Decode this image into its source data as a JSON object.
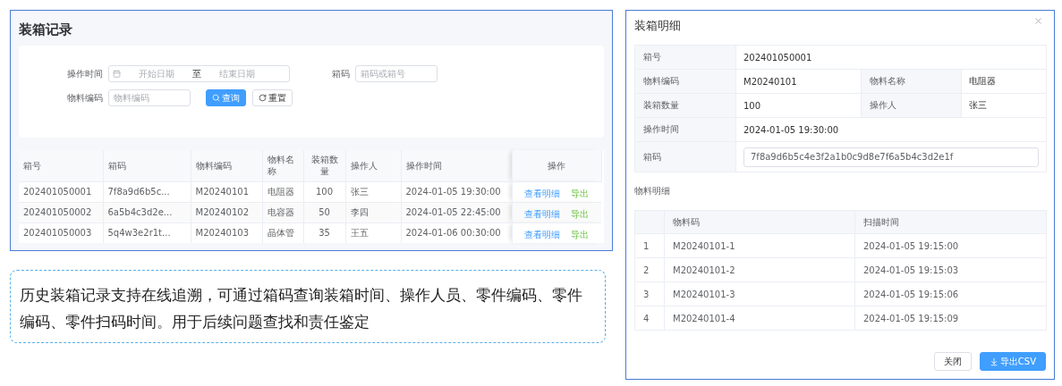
{
  "records_panel": {
    "title": "装箱记录",
    "filters": {
      "time_label": "操作时间",
      "start_placeholder": "开始日期",
      "range_separator": "至",
      "end_placeholder": "结束日期",
      "box_code_label": "箱码",
      "box_code_placeholder": "箱码或箱号",
      "material_label": "物料编码",
      "material_placeholder": "物料编码",
      "buttons": [
        {
          "kind": "primary",
          "label": "查询"
        },
        {
          "kind": "default",
          "label": "重置"
        }
      ]
    },
    "table": {
      "columns": [
        "箱号",
        "箱码",
        "物料编码",
        "物料名称",
        "装箱数量",
        "操作人",
        "操作时间",
        "操作"
      ],
      "rows": [
        {
          "cells": [
            "202401050001",
            "7f8a9d6b5c...",
            "M20240101",
            "电阻器",
            "100",
            "张三",
            "2024-01-05 19:30:00"
          ],
          "actions": [
            {
              "kind": "detail",
              "label": "查看明细"
            },
            {
              "kind": "export",
              "label": "导出"
            }
          ]
        },
        {
          "cells": [
            "202401050002",
            "6a5b4c3d2e...",
            "M20240102",
            "电容器",
            "50",
            "李四",
            "2024-01-05 22:45:00"
          ],
          "actions": [
            {
              "kind": "detail",
              "label": "查看明细"
            },
            {
              "kind": "export",
              "label": "导出"
            }
          ]
        },
        {
          "cells": [
            "202401050003",
            "5q4w3e2r1t...",
            "M20240103",
            "晶体管",
            "35",
            "王五",
            "2024-01-06 00:30:00"
          ],
          "actions": [
            {
              "kind": "detail",
              "label": "查看明细"
            },
            {
              "kind": "export",
              "label": "导出"
            }
          ]
        }
      ]
    }
  },
  "caption": "历史装箱记录支持在线追溯，可通过箱码查询装箱时间、操作人员、零件编码、零件编码、零件扫码时间。用于后续问题查找和责任鉴定",
  "detail_dialog": {
    "title": "装箱明细",
    "fields": [
      [
        {
          "kind": "text",
          "label": "箱号",
          "value": "202401050001"
        }
      ],
      [
        {
          "kind": "text",
          "label": "物料编码",
          "value": "M20240101"
        },
        {
          "kind": "text",
          "label": "物料名称",
          "value": "电阻器"
        }
      ],
      [
        {
          "kind": "text",
          "label": "装箱数量",
          "value": "100"
        },
        {
          "kind": "text",
          "label": "操作人",
          "value": "张三"
        }
      ],
      [
        {
          "kind": "text",
          "label": "操作时间",
          "value": "2024-01-05 19:30:00"
        }
      ],
      [
        {
          "kind": "input",
          "label": "箱码",
          "value": "7f8a9d6b5c4e3f2a1b0c9d8e7f6a5b4c3d2e1f"
        }
      ]
    ],
    "section_title": "物料明细",
    "items_table": {
      "columns": [
        "",
        "物料码",
        "扫描时间"
      ],
      "rows": [
        [
          "1",
          "M20240101-1",
          "2024-01-05 19:15:00"
        ],
        [
          "2",
          "M20240101-2",
          "2024-01-05 19:15:03"
        ],
        [
          "3",
          "M20240101-3",
          "2024-01-05 19:15:06"
        ],
        [
          "4",
          "M20240101-4",
          "2024-01-05 19:15:09"
        ]
      ]
    },
    "buttons": [
      {
        "kind": "default",
        "label": "关闭"
      },
      {
        "kind": "primary",
        "label": "导出CSV"
      }
    ]
  }
}
